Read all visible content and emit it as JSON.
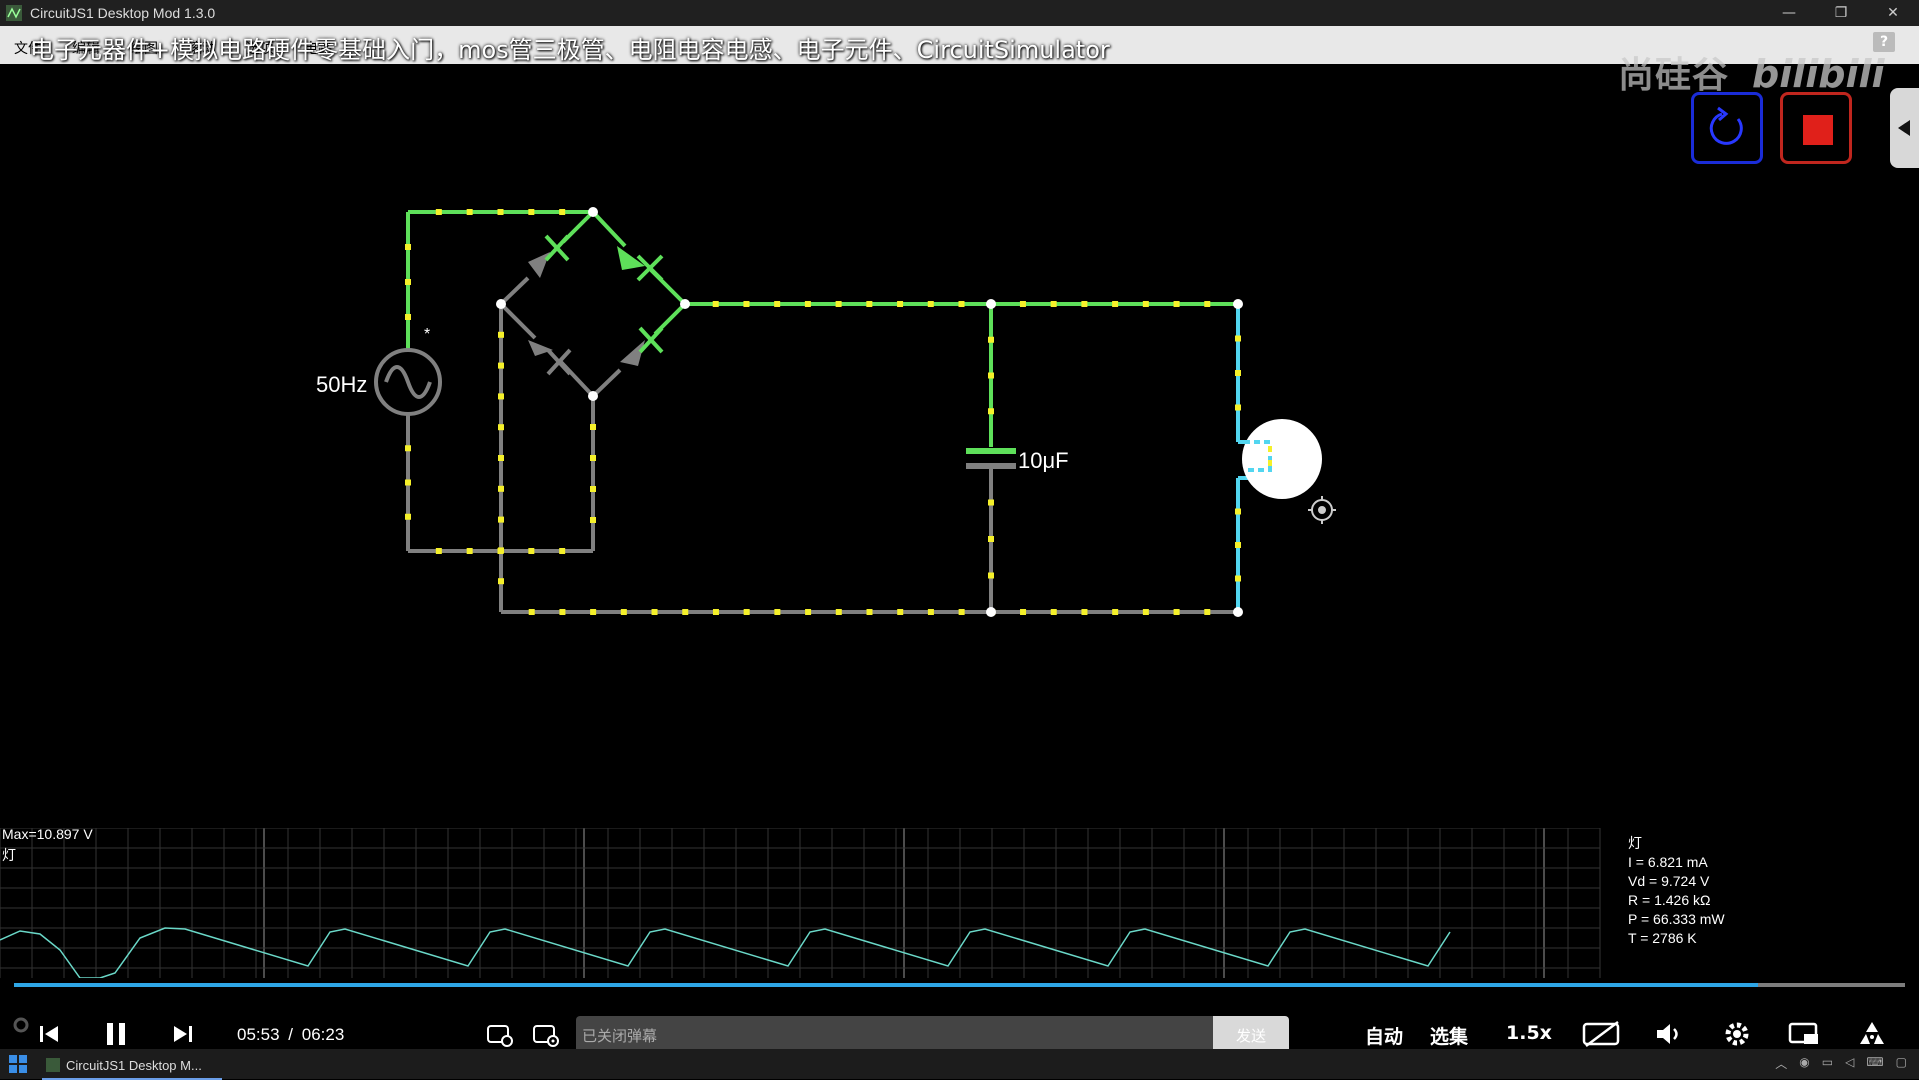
{
  "window": {
    "title": "CircuitJS1 Desktop Mod 1.3.0",
    "minimize": "—",
    "restore": "❐",
    "close": "✕"
  },
  "menu": {
    "items": [
      "文件",
      "编辑",
      "绘图",
      "滚动",
      "选项",
      "电路"
    ]
  },
  "video": {
    "title": "电子元器件+模拟电路硬件零基础入门，mos管三极管、电阻电容电感、电子元件、CircuitSimulator"
  },
  "watermark": {
    "text": "尚硅谷",
    "bili": "bilibili"
  },
  "help": {
    "label": "?"
  },
  "circuit": {
    "source_label": "50Hz",
    "source_marker": "*",
    "capacitor_label": "10μF"
  },
  "scope": {
    "max_label": "Max=10.897 V",
    "element_label": "灯",
    "info": {
      "name": "灯",
      "current": "I = 6.821 mA",
      "voltage": "Vd = 9.724 V",
      "resistance": "R = 1.426 kΩ",
      "power": "P = 66.333 mW",
      "temperature": "T = 2786 K"
    }
  },
  "player": {
    "current_time": "05:53",
    "separator": "/",
    "total_time": "06:23",
    "progress": 0.922,
    "danmaku_placeholder": "已关闭弹幕",
    "send_label": "发送",
    "quality_label": "自动",
    "episodes_label": "选集",
    "speed_label": "1.5x"
  },
  "taskbar": {
    "item_label": "CircuitJS1 Desktop M..."
  },
  "colors": {
    "wire_green": "#5ee05a",
    "wire_gray": "#808080",
    "wire_cyan": "#52d6f0",
    "dot_yellow": "#f5f02a",
    "progress": "#2ea6e6"
  }
}
